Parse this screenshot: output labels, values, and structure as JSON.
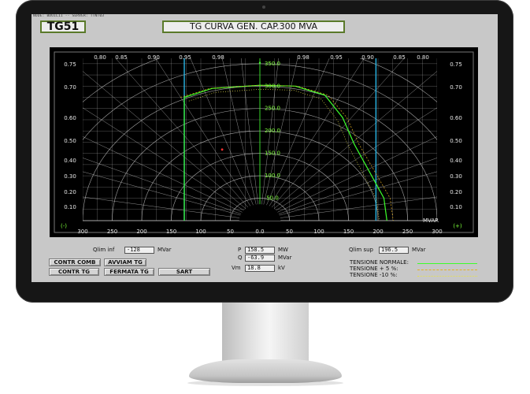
{
  "header": {
    "node_label": "NODE: BDUIL11 -- SERVER: TTNT03",
    "unit": "TG51",
    "title": "TG CURVA GEN. CAP.300 MVA"
  },
  "chart": {
    "pf_top_labels": [
      "0.80",
      "0.85",
      "0.90",
      "0.95",
      "0.98",
      "0.98",
      "0.95",
      "0.90",
      "0.85",
      "0.80"
    ],
    "pf_left_labels": [
      "0.75",
      "0.70",
      "0.60",
      "0.50",
      "0.40",
      "0.30",
      "0.20",
      "0.10"
    ],
    "pf_right_labels": [
      "0.75",
      "0.70",
      "0.60",
      "0.50",
      "0.40",
      "0.30",
      "0.20",
      "0.10"
    ],
    "mw_labels": [
      "350.0",
      "300.0",
      "250.0",
      "200.0",
      "150.0",
      "100.0",
      "50.0"
    ],
    "mvar_labels": [
      "300",
      "250",
      "200",
      "150",
      "100",
      "50",
      "0.0",
      "50",
      "100",
      "150",
      "200",
      "250",
      "300"
    ],
    "minus_label": "(-)",
    "plus_label": "(+)",
    "mvar_axis_label": "MVAR",
    "capability_curve": [
      [
        -128,
        275
      ],
      [
        -80,
        295
      ],
      [
        0,
        302
      ],
      [
        60,
        300
      ],
      [
        110,
        280
      ],
      [
        140,
        230
      ],
      [
        160,
        170
      ],
      [
        185,
        110
      ],
      [
        210,
        50
      ],
      [
        215,
        0
      ]
    ],
    "qlim_inf": -128,
    "qlim_sup": 196.5,
    "operating_point": {
      "q": -63.9,
      "p": 158.5
    },
    "colors": {
      "background": "#000000",
      "grid": "#cfcfcf",
      "curve": "#3cff2a",
      "limit": "#2ab7e6",
      "operating_point": "#ff3333"
    }
  },
  "controls": {
    "qlim_inf_label": "Qlim inf",
    "qlim_inf_value": "-128",
    "qlim_inf_unit": "MVar",
    "qlim_sup_label": "Qlim sup",
    "qlim_sup_value": "196.5",
    "qlim_sup_unit": "MVar",
    "p_label": "P",
    "p_value": "158.5",
    "p_unit": "MW",
    "q_label": "Q",
    "q_value": "-63.9",
    "q_unit": "MVar",
    "vm_label": "Vm",
    "vm_value": "18.8",
    "vm_unit": "kV"
  },
  "buttons": {
    "contr_comb": "CONTR COMB",
    "avviam_tg": "AVVIAM TG",
    "contr_tg": "CONTR TG",
    "fermata_tg": "FERMATA TG",
    "sart": "SART"
  },
  "legend": {
    "normal": "TENSIONE NORMALE:",
    "plus5": "TENSIONE  + 5 %:",
    "minus10": "TENSIONE  -10 %:",
    "normal_color": "#3cff2a",
    "plus5_color": "#e6b020",
    "minus10_color": "#e6e04a"
  }
}
